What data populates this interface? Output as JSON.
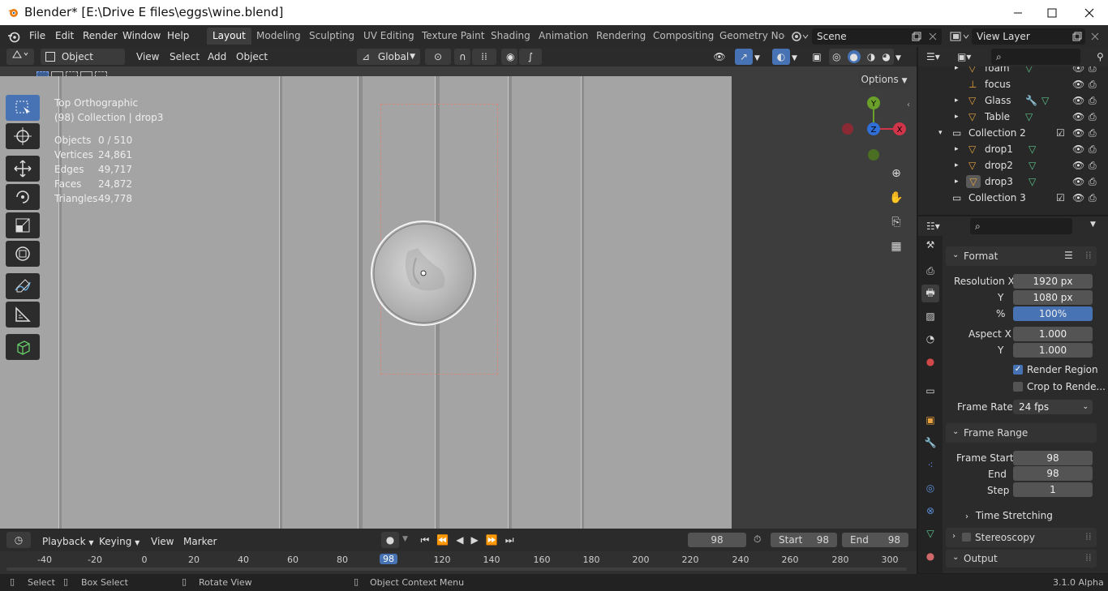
{
  "titlebar": {
    "title": "Blender* [E:\\Drive E files\\eggs\\wine.blend]"
  },
  "menu": [
    "File",
    "Edit",
    "Render",
    "Window",
    "Help"
  ],
  "workspaces": [
    "Layout",
    "Modeling",
    "Sculpting",
    "UV Editing",
    "Texture Paint",
    "Shading",
    "Animation",
    "Rendering",
    "Compositing",
    "Geometry Nod"
  ],
  "scene": {
    "name": "Scene"
  },
  "view_layer": {
    "name": "View Layer"
  },
  "header": {
    "mode": "Object Mode",
    "menus": [
      "View",
      "Select",
      "Add",
      "Object"
    ],
    "transform": "Global",
    "options": "Options"
  },
  "viewport": {
    "view_name": "Top Orthographic",
    "collection_info": "(98) Collection | drop3",
    "stats": [
      {
        "label": "Objects",
        "value": "0 / 510"
      },
      {
        "label": "Vertices",
        "value": "24,861"
      },
      {
        "label": "Edges",
        "value": "49,717"
      },
      {
        "label": "Faces",
        "value": "24,872"
      },
      {
        "label": "Triangles",
        "value": "49,778"
      }
    ],
    "gizmo_axes": {
      "x": "X",
      "y": "Y",
      "z": "Z"
    }
  },
  "outliner": {
    "rows": [
      {
        "label": "foam"
      },
      {
        "label": "focus"
      },
      {
        "label": "Glass"
      },
      {
        "label": "Table"
      },
      {
        "label": "Collection 2"
      },
      {
        "label": "drop1"
      },
      {
        "label": "drop2"
      },
      {
        "label": "drop3"
      },
      {
        "label": "Collection 3"
      }
    ]
  },
  "properties": {
    "format": {
      "title": "Format",
      "res_x_label": "Resolution X",
      "res_x": "1920 px",
      "res_y_label": "Y",
      "res_y": "1080 px",
      "pct_label": "%",
      "pct": "100%",
      "aspect_x_label": "Aspect X",
      "aspect_x": "1.000",
      "aspect_y_label": "Y",
      "aspect_y": "1.000",
      "render_region": "Render Region",
      "crop": "Crop to Rende...",
      "frame_rate_label": "Frame Rate",
      "frame_rate": "24 fps"
    },
    "frame_range": {
      "title": "Frame Range",
      "start_label": "Frame Start",
      "start": "98",
      "end_label": "End",
      "end": "98",
      "step_label": "Step",
      "step": "1"
    },
    "time_stretching": "Time Stretching",
    "stereoscopy": "Stereoscopy",
    "output": "Output"
  },
  "timeline": {
    "menus": [
      "Playback",
      "Keying",
      "View",
      "Marker"
    ],
    "current_frame": "98",
    "start_label": "Start",
    "start": "98",
    "end_label": "End",
    "end": "98",
    "ruler": [
      "-40",
      "-20",
      "0",
      "20",
      "40",
      "60",
      "80",
      "98",
      "120",
      "140",
      "160",
      "180",
      "200",
      "220",
      "240",
      "260",
      "280",
      "300"
    ]
  },
  "statusbar": {
    "select": "Select",
    "box_select": "Box Select",
    "rotate": "Rotate View",
    "context": "Object Context Menu",
    "version": "3.1.0 Alpha"
  }
}
